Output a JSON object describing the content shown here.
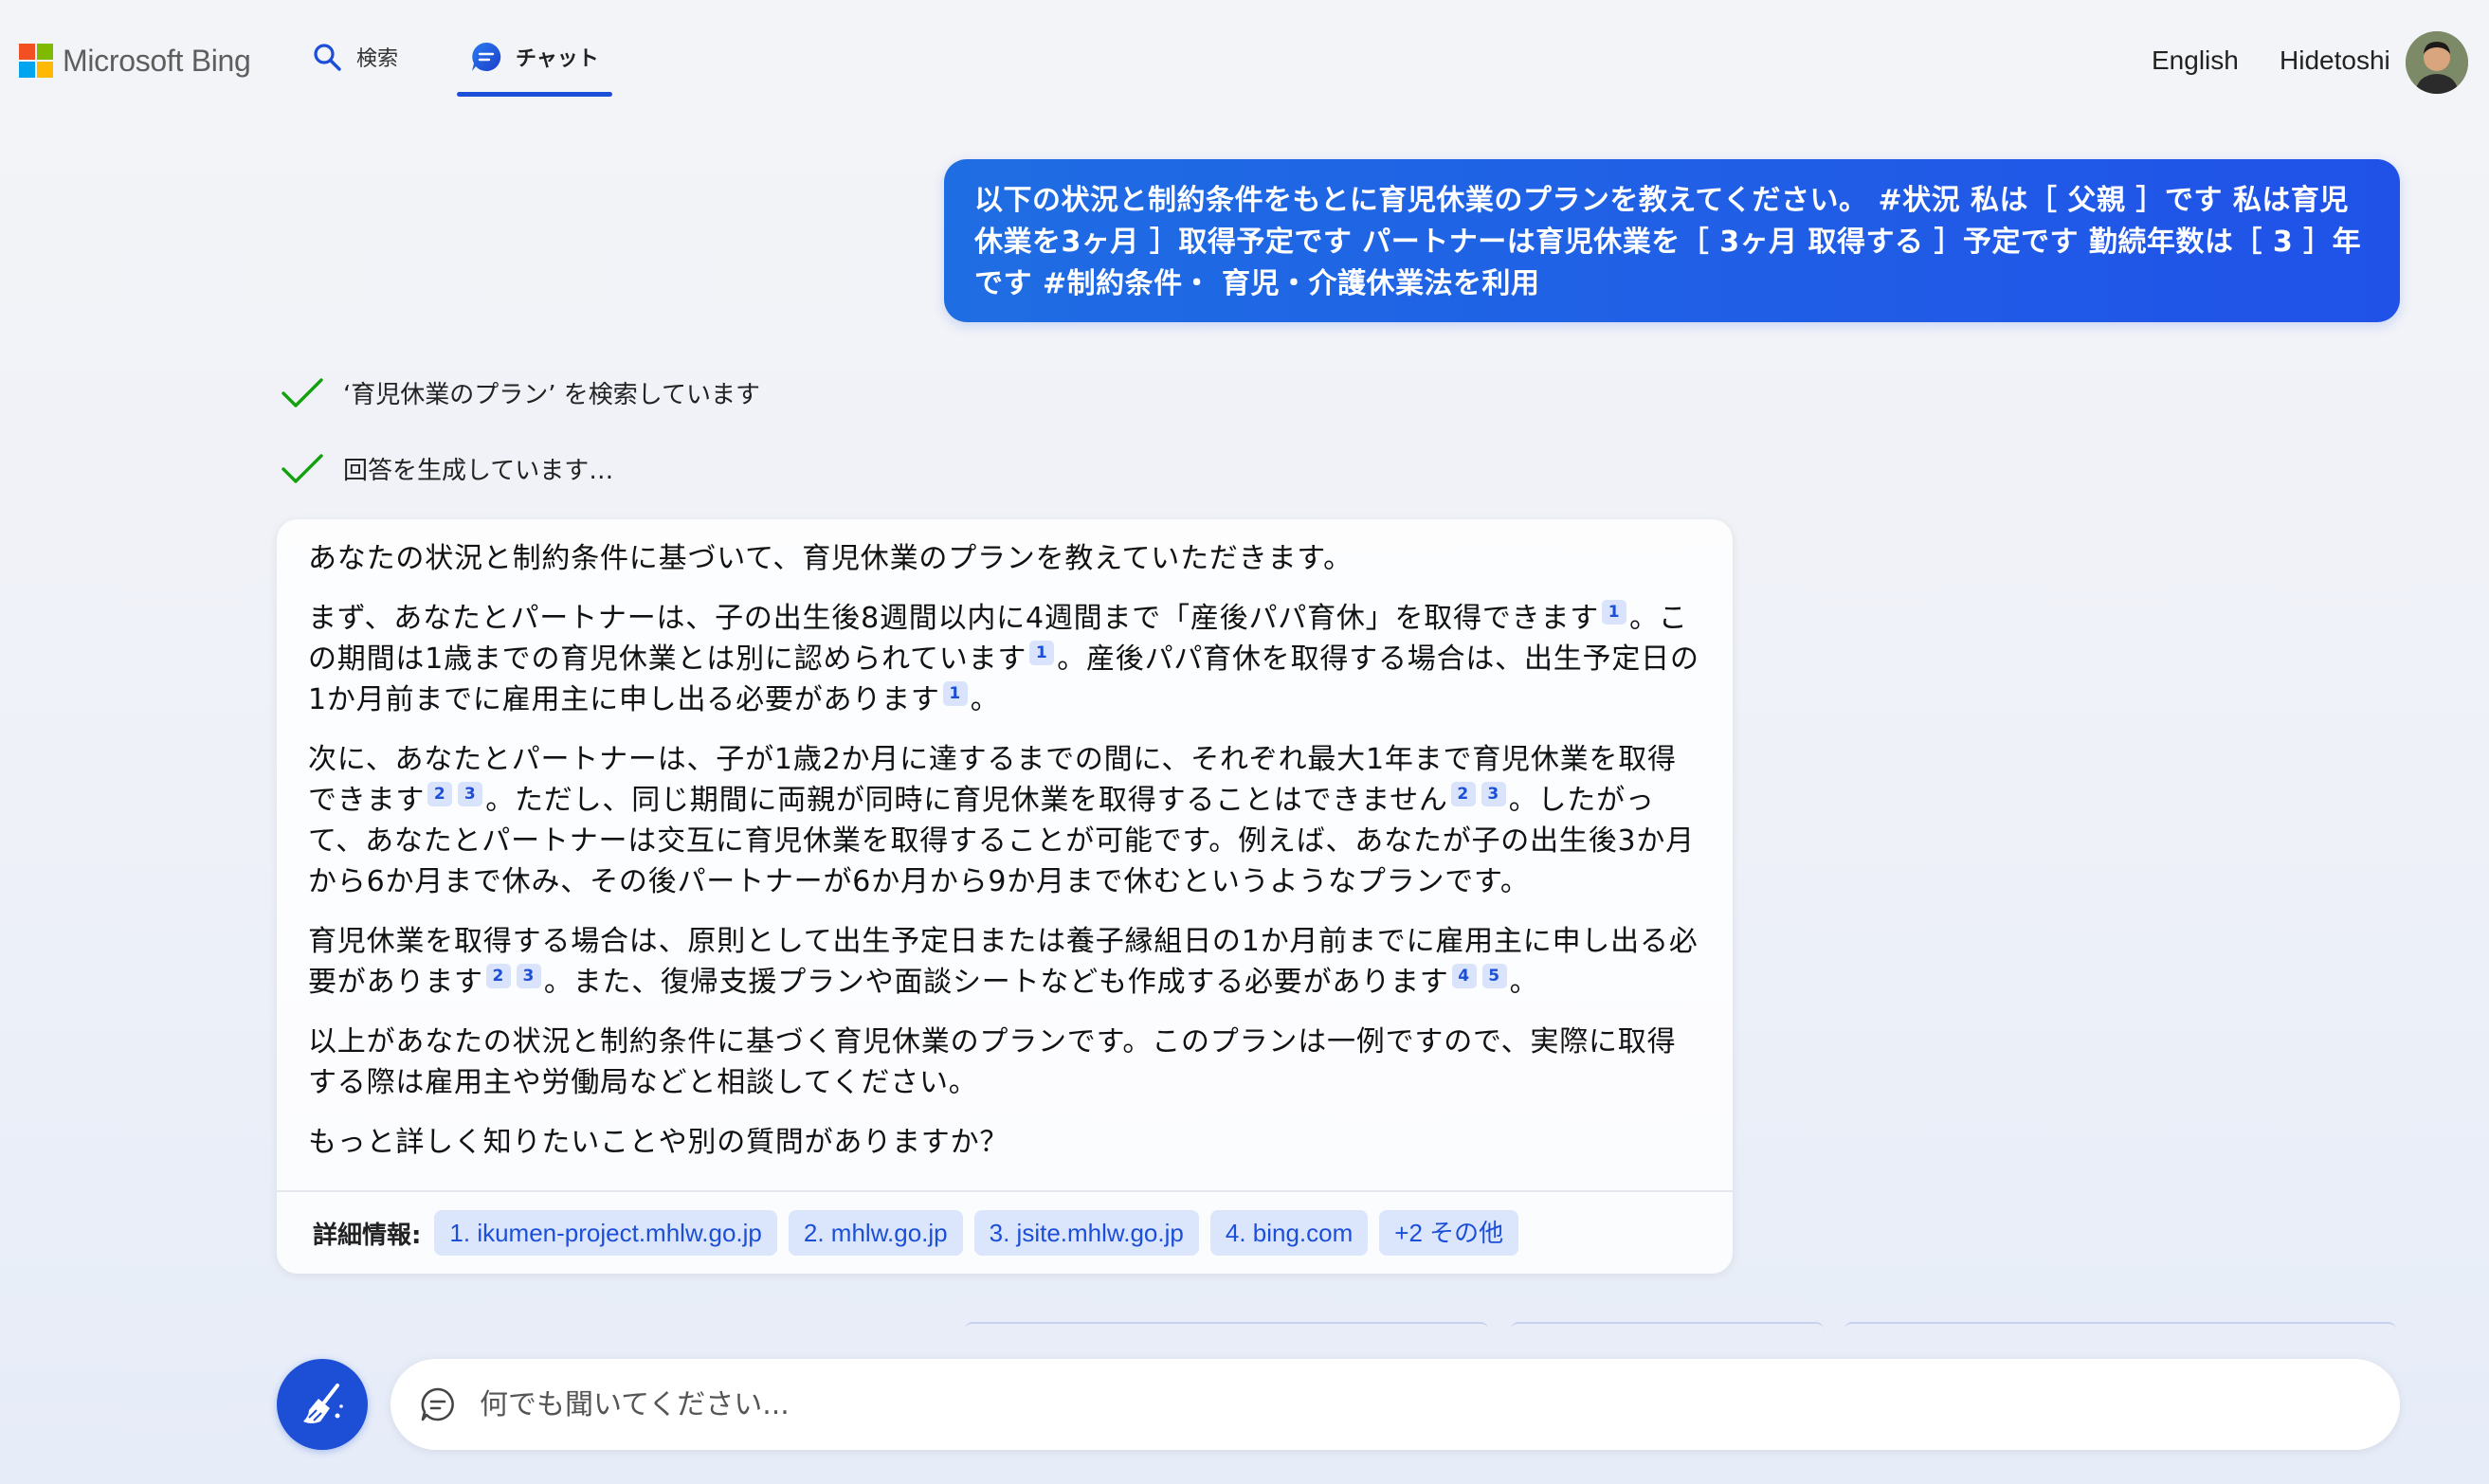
{
  "brand": {
    "name": "Microsoft Bing",
    "colors": {
      "red": "#f25022",
      "green": "#7fba00",
      "blue": "#00a4ef",
      "yellow": "#ffb900"
    }
  },
  "nav": {
    "search_label": "検索",
    "chat_label": "チャット",
    "active_tab": "チャット",
    "accent": "#1b4fd8"
  },
  "account": {
    "language": "English",
    "username": "Hidetoshi"
  },
  "user_message": "以下の状況と制約条件をもとに育児休業のプランを教えてください。 #状況 私は［ 父親 ］です 私は育児休業を3ヶ月 ］取得予定です パートナーは育児休業を［ 3ヶ月 取得する ］予定です 勤続年数は［ 3 ］年です #制約条件・ 育児・介護休業法を利用",
  "progress": [
    {
      "text": "‘育児休業のプラン’ を検索しています"
    },
    {
      "text": "回答を生成しています…"
    }
  ],
  "answer": {
    "p1": "あなたの状況と制約条件に基づいて、育児休業のプランを教えていただきます。",
    "p2_a": "まず、あなたとパートナーは、子の出生後8週間以内に4週間まで「産後パパ育休」を取得できます",
    "p2_b": "。この期間は1歳までの育児休業とは別に認められています",
    "p2_c": "。産後パパ育休を取得する場合は、出生予定日の1か月前までに雇用主に申し出る必要があります",
    "p2_d": "。",
    "p3_a": "次に、あなたとパートナーは、子が1歳2か月に達するまでの間に、それぞれ最大1年まで育児休業を取得できます",
    "p3_b": "。ただし、同じ期間に両親が同時に育児休業を取得することはできません",
    "p3_c": "。したがって、あなたとパートナーは交互に育児休業を取得することが可能です。例えば、あなたが子の出生後3か月から6か月まで休み、その後パートナーが6か月から9か月まで休むというようなプランです。",
    "p4_a": "育児休業を取得する場合は、原則として出生予定日または養子縁組日の1か月前までに雇用主に申し出る必要があります",
    "p4_b": "。また、復帰支援プランや面談シートなども作成する必要があります",
    "p4_c": "。",
    "p5": "以上があなたの状況と制約条件に基づく育児休業のプランです。このプランは一例ですので、実際に取得する際は雇用主や労働局などと相談してください。",
    "p6": "もっと詳しく知りたいことや別の質問がありますか？",
    "cite": {
      "one": "1",
      "two": "2",
      "three": "3",
      "four": "4",
      "five": "5"
    }
  },
  "learn_more": {
    "label": "詳細情報:",
    "sources": [
      "1. ikumen-project.mhlw.go.jp",
      "2. mhlw.go.jp",
      "3. jsite.mhlw.go.jp",
      "4. bing.com",
      "+2 その他"
    ]
  },
  "composer": {
    "placeholder": "何でも聞いてください..."
  }
}
